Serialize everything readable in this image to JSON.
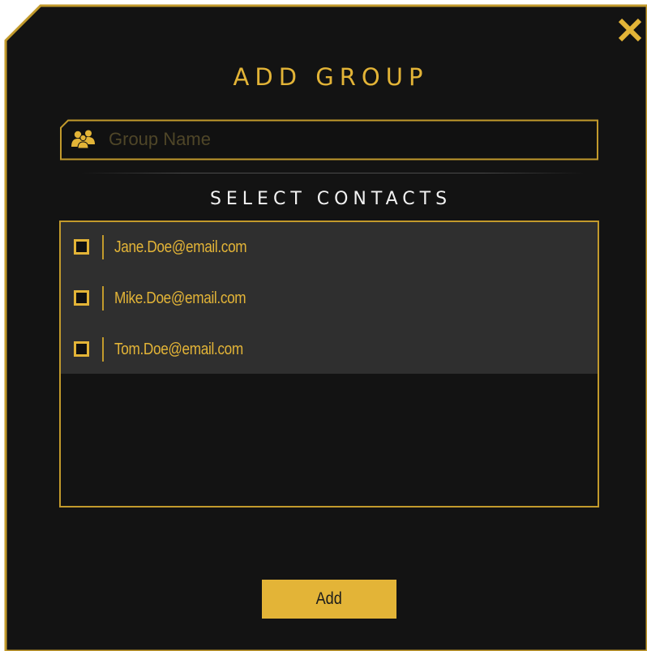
{
  "dialog": {
    "title": "ADD GROUP",
    "close_icon": "close-x-icon"
  },
  "group_name": {
    "placeholder": "Group Name",
    "value": "",
    "icon": "group-users-icon"
  },
  "contacts": {
    "title": "SELECT CONTACTS",
    "items": [
      {
        "email": "Jane.Doe@email.com",
        "checked": false
      },
      {
        "email": "Mike.Doe@email.com",
        "checked": false
      },
      {
        "email": "Tom.Doe@email.com",
        "checked": false
      }
    ]
  },
  "actions": {
    "add_label": "Add"
  },
  "colors": {
    "accent": "#e3b437",
    "background": "#131313",
    "list_background": "#2f2f2f",
    "frame_border": "#c29a2c"
  }
}
